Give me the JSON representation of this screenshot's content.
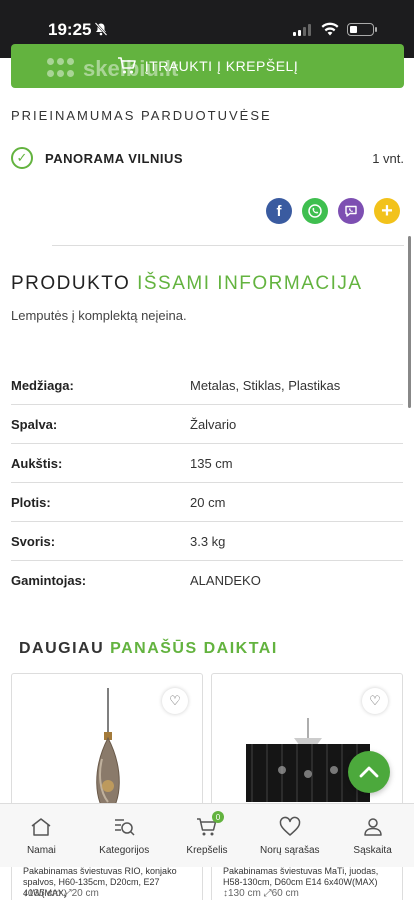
{
  "status_bar": {
    "time": "19:25"
  },
  "cart_button": {
    "label": "ĮTRAUKTI Į KREPŠELĮ",
    "watermark": "skelbiu.lt"
  },
  "availability": {
    "title": "PRIEINAMUMAS PARDUOTUVĖSE",
    "store": "PANORAMA VILNIUS",
    "quantity": "1 vnt."
  },
  "share_icons": [
    "facebook-icon",
    "whatsapp-icon",
    "viber-icon",
    "more-icon"
  ],
  "details": {
    "title_plain": "PRODUKTO ",
    "title_highlight": "IŠSAMI INFORMACIJA",
    "description": "Lemputės į komplektą neįeina."
  },
  "specs": [
    {
      "key": "Medžiaga:",
      "value": "Metalas, Stiklas, Plastikas"
    },
    {
      "key": "Spalva:",
      "value": "Žalvario"
    },
    {
      "key": "Aukštis:",
      "value": "135 cm"
    },
    {
      "key": "Plotis:",
      "value": "20 cm"
    },
    {
      "key": "Svoris:",
      "value": "3.3 kg"
    },
    {
      "key": "Gamintojas:",
      "value": "ALANDEKO"
    }
  ],
  "similar": {
    "title_plain": "DAUGIAU ",
    "title_highlight": "PANAŠŪS DAIKTAI",
    "products": [
      {
        "title": "Pakabinamas šviestuvas RIO, konjako spalvos, H60-135cm, D20cm, E27 40W(MAX)",
        "dims": "↕135 cm  ⤢20 cm"
      },
      {
        "title": "Pakabinamas šviestuvas MaTi, juodas, H58-130cm, D60cm E14 6x40W(MAX)",
        "dims": "↕130 cm  ⤢60 cm"
      }
    ]
  },
  "tabbar": {
    "items": [
      {
        "label": "Namai",
        "icon": "home-icon"
      },
      {
        "label": "Kategorijos",
        "icon": "category-search-icon"
      },
      {
        "label": "Krepšelis",
        "icon": "cart-icon",
        "badge": "0"
      },
      {
        "label": "Norų sąrašas",
        "icon": "heart-icon"
      },
      {
        "label": "Sąskaita",
        "icon": "user-icon"
      }
    ]
  },
  "colors": {
    "accent": "#63b33f",
    "fab": "#4ca93c"
  }
}
